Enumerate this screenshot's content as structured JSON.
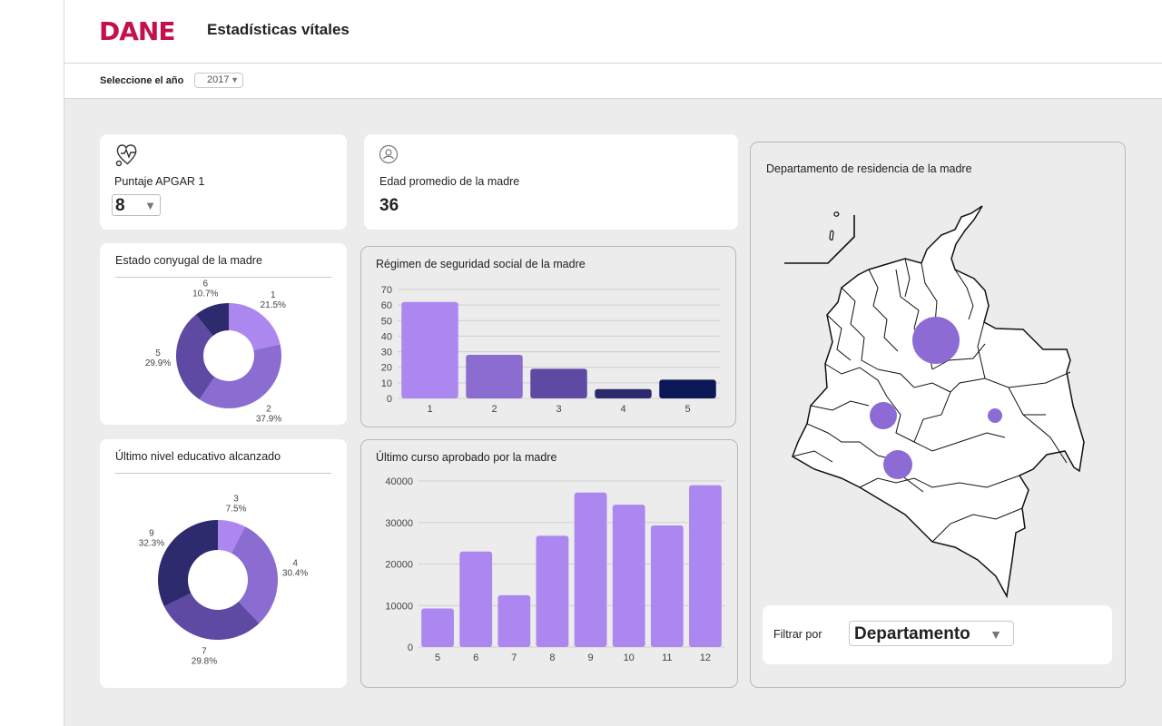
{
  "header": {
    "logo": "DANE",
    "title": "Estadísticas vítales"
  },
  "year_filter": {
    "label": "Seleccione el año",
    "value": "2017"
  },
  "apgar": {
    "title": "Puntaje APGAR 1",
    "value": "8",
    "icon": "heart-stethoscope-icon"
  },
  "edad": {
    "title": "Edad promedio de la madre",
    "value": "36",
    "icon": "mother-avatar-icon"
  },
  "map": {
    "title": "Departamento de residencia de la madre",
    "filter_label": "Filtrar por",
    "filter_value": "Departamento",
    "bubble_color": "#8c6bd5"
  },
  "colors": {
    "brand": "#c4104f",
    "purple_1": "#ad87f0",
    "purple_2": "#8b6dd1",
    "purple_3": "#5e4aa3",
    "purple_4": "#2d2a6e",
    "purple_5": "#0c1856"
  },
  "chart_data": [
    {
      "id": "estado",
      "type": "pie",
      "title": "Estado conyugal de la madre",
      "slices": [
        {
          "label": "1",
          "pct": "21.5%",
          "value": 21.5,
          "color": "#ad87f0"
        },
        {
          "label": "2",
          "pct": "37.9%",
          "value": 37.9,
          "color": "#8b6dd1"
        },
        {
          "label": "5",
          "pct": "29.9%",
          "value": 29.9,
          "color": "#5e4aa3"
        },
        {
          "label": "6",
          "pct": "10.7%",
          "value": 10.7,
          "color": "#2d2a6e"
        }
      ]
    },
    {
      "id": "regimen",
      "type": "bar",
      "title": "Régimen de seguridad social de la madre",
      "categories": [
        "1",
        "2",
        "3",
        "4",
        "5"
      ],
      "values": [
        62,
        28,
        19,
        6,
        12
      ],
      "colors": [
        "#ad87f0",
        "#8b6dd1",
        "#5e4aa3",
        "#2d2a6e",
        "#0c1856"
      ],
      "ylim": [
        0,
        70
      ],
      "yticks": [
        "0",
        "10",
        "20",
        "30",
        "40",
        "50",
        "60",
        "70"
      ],
      "grid": true
    },
    {
      "id": "nivel",
      "type": "pie",
      "title": "Último nivel educativo alcanzado",
      "slices": [
        {
          "label": "3",
          "pct": "7.5%",
          "value": 7.5,
          "color": "#ad87f0"
        },
        {
          "label": "4",
          "pct": "30.4%",
          "value": 30.4,
          "color": "#8b6dd1"
        },
        {
          "label": "7",
          "pct": "29.8%",
          "value": 29.8,
          "color": "#5e4aa3"
        },
        {
          "label": "9",
          "pct": "32.3%",
          "value": 32.3,
          "color": "#2d2a6e"
        }
      ]
    },
    {
      "id": "curso",
      "type": "bar",
      "title": "Último curso aprobado por la madre",
      "categories": [
        "5",
        "6",
        "7",
        "8",
        "9",
        "10",
        "11",
        "12"
      ],
      "values": [
        9300,
        23000,
        12500,
        26800,
        37200,
        34300,
        29300,
        39000
      ],
      "colors": [
        "#ad87f0"
      ],
      "ylim": [
        0,
        40000
      ],
      "yticks": [
        "0",
        "10000",
        "20000",
        "30000",
        "40000"
      ],
      "grid": true
    }
  ]
}
